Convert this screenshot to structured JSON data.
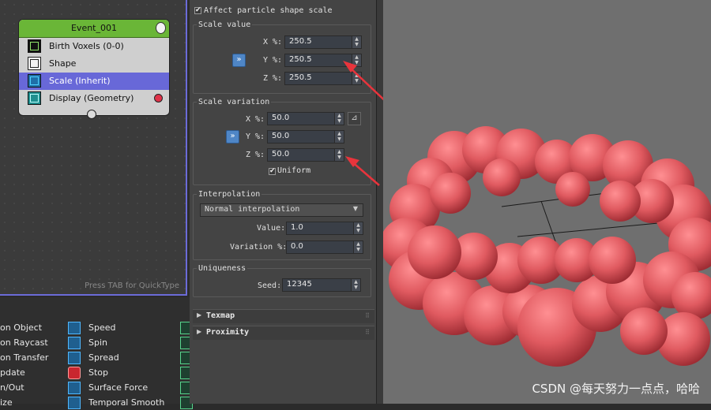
{
  "node_editor": {
    "event": {
      "title": "Event_001",
      "operators": [
        {
          "label": "Birth Voxels (0-0)",
          "icon": "birth-voxels-icon"
        },
        {
          "label": "Shape",
          "icon": "shape-icon"
        },
        {
          "label": "Scale (Inherit)",
          "icon": "scale-icon",
          "selected": true
        },
        {
          "label": "Display (Geometry)",
          "icon": "display-icon"
        }
      ]
    },
    "quicktype_hint": "Press TAB for QuickType",
    "selection_color": "#6868d8",
    "event_header_color": "#6ab637"
  },
  "depot": {
    "col1": [
      "on Object",
      "on Raycast",
      "on Transfer",
      "pdate",
      "n/Out",
      "ize"
    ],
    "col2": [
      {
        "label": "Speed",
        "icon": "speed-icon"
      },
      {
        "label": "Spin",
        "icon": "spin-icon"
      },
      {
        "label": "Spread",
        "icon": "spread-icon"
      },
      {
        "label": "Stop",
        "icon": "stop-icon"
      },
      {
        "label": "Surface Force",
        "icon": "surface-force-icon"
      },
      {
        "label": "Temporal Smooth",
        "icon": "temporal-smooth-icon"
      }
    ]
  },
  "params": {
    "affect_shape_scale": {
      "label": "Affect particle shape scale",
      "checked": true
    },
    "scale_value": {
      "title": "Scale value",
      "x": {
        "label": "X %:",
        "value": "250.5"
      },
      "y": {
        "label": "Y %:",
        "value": "250.5"
      },
      "z": {
        "label": "Z %:",
        "value": "250.5"
      },
      "link_button": "»"
    },
    "scale_variation": {
      "title": "Scale variation",
      "x": {
        "label": "X %:",
        "value": "50.0"
      },
      "y": {
        "label": "Y %:",
        "value": "50.0"
      },
      "z": {
        "label": "Z %:",
        "value": "50.0"
      },
      "link_button": "»",
      "uniform": {
        "label": "Uniform",
        "checked": true
      }
    },
    "interpolation": {
      "title": "Interpolation",
      "mode": "Normal interpolation",
      "value": {
        "label": "Value:",
        "value": "1.0"
      },
      "variation": {
        "label": "Variation %:",
        "value": "0.0"
      }
    },
    "uniqueness": {
      "title": "Uniqueness",
      "seed": {
        "label": "Seed:",
        "value": "12345"
      }
    },
    "rollouts": [
      {
        "label": "Texmap"
      },
      {
        "label": "Proximity"
      }
    ],
    "arrow_color": "#e8343c"
  },
  "viewport": {
    "sphere_color": "#e05a60",
    "watermark": "CSDN @每天努力一点点，哈哈"
  }
}
